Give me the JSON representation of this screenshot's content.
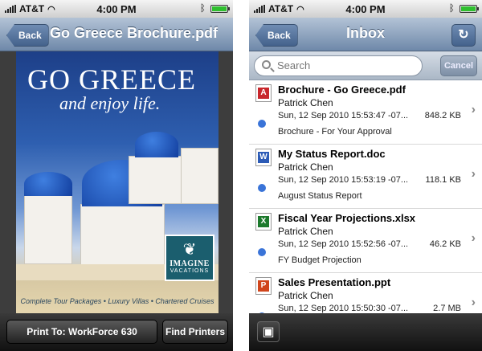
{
  "status_bar": {
    "carrier": "AT&T",
    "time": "4:00 PM"
  },
  "left": {
    "back_label": "Back",
    "title": "Go Greece Brochure.pdf",
    "brochure": {
      "headline": "GO GREECE",
      "tagline": "and enjoy life.",
      "logo_title": "IMAGINE",
      "logo_sub": "VACATIONS",
      "footer": "Complete Tour Packages • Luxury Villas • Chartered Cruises"
    },
    "print_label": "Print To: WorkForce 630",
    "find_label": "Find Printers"
  },
  "right": {
    "back_label": "Back",
    "title": "Inbox",
    "search_placeholder": "Search",
    "cancel_label": "Cancel",
    "messages": [
      {
        "subject": "Brochure - Go Greece.pdf",
        "sender": "Patrick Chen",
        "date": "Sun, 12 Sep 2010 15:53:47 -07...",
        "size": "848.2 KB",
        "body": "Brochure - For Your Approval",
        "icon": "pdf-icon",
        "icon_color": "#c8262b"
      },
      {
        "subject": "My Status Report.doc",
        "sender": "Patrick Chen",
        "date": "Sun, 12 Sep 2010 15:53:19 -07...",
        "size": "118.1 KB",
        "body": "August Status Report",
        "icon": "word-doc-icon",
        "icon_color": "#2c5bb6"
      },
      {
        "subject": "Fiscal Year Projections.xlsx",
        "sender": "Patrick Chen",
        "date": "Sun, 12 Sep 2010 15:52:56 -07...",
        "size": "46.2 KB",
        "body": "FY Budget Projection",
        "icon": "excel-icon",
        "icon_color": "#1d7a2d"
      },
      {
        "subject": "Sales Presentation.ppt",
        "sender": "Patrick Chen",
        "date": "Sun, 12 Sep 2010 15:50:30 -07...",
        "size": "2.7 MB",
        "body": "",
        "icon": "powerpoint-icon",
        "icon_color": "#d0451b"
      }
    ]
  },
  "colors": {
    "nav_blue": "#6e88a9",
    "unread_dot": "#3a74d8",
    "battery_green": "#2fbf2f"
  }
}
